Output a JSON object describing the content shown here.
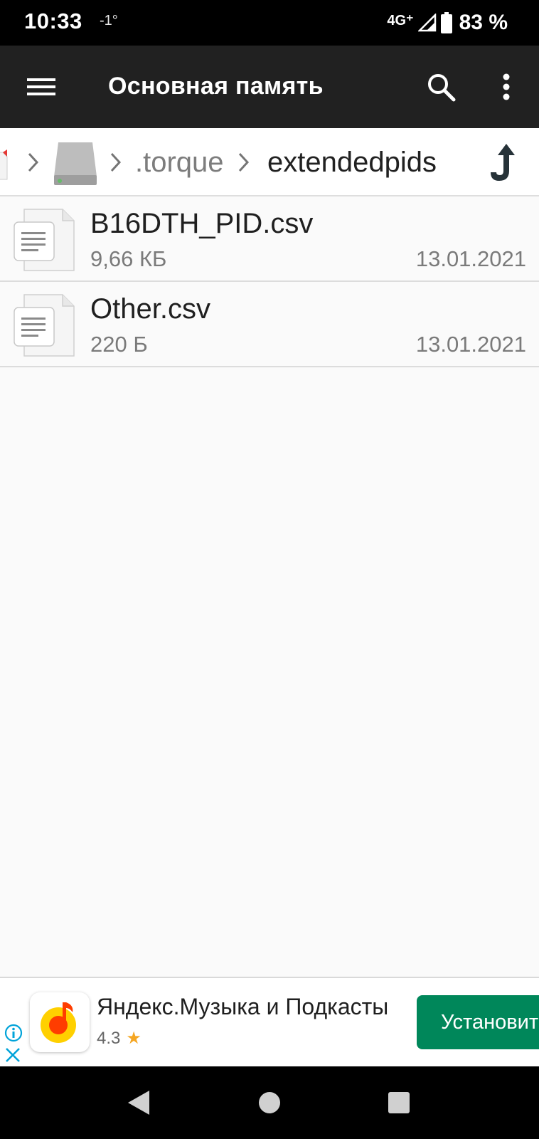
{
  "status_bar": {
    "time": "10:33",
    "temperature": "-1°",
    "network": "4G⁺",
    "battery_percent": "83 %"
  },
  "app_bar": {
    "title": "Основная память",
    "icons": [
      "menu-icon",
      "search-icon",
      "more-vert-icon"
    ]
  },
  "breadcrumb": {
    "items": [
      ".torque",
      "extendedpids"
    ],
    "icons": [
      "sd-card-icon",
      "internal-storage-icon",
      "up-arrow-icon"
    ]
  },
  "files": [
    {
      "name": "B16DTH_PID.csv",
      "size": "9,66 КБ",
      "date": "13.01.2021",
      "icon": "text-file-icon"
    },
    {
      "name": "Other.csv",
      "size": "220 Б",
      "date": "13.01.2021",
      "icon": "text-file-icon"
    }
  ],
  "ad": {
    "title": "Яндекс.Музыка и Подкасты",
    "rating": "4.3",
    "install_label": "Установить",
    "install_color": "#00875a",
    "icons": [
      "ad-info-icon",
      "ad-close-icon",
      "yandex-music-app-icon",
      "star-icon"
    ]
  },
  "nav_bar": {
    "icons": [
      "back-icon",
      "home-icon",
      "recents-icon"
    ]
  },
  "colors": {
    "app_bar": "#212121",
    "background": "#fafafa",
    "status_bar": "#000000"
  }
}
